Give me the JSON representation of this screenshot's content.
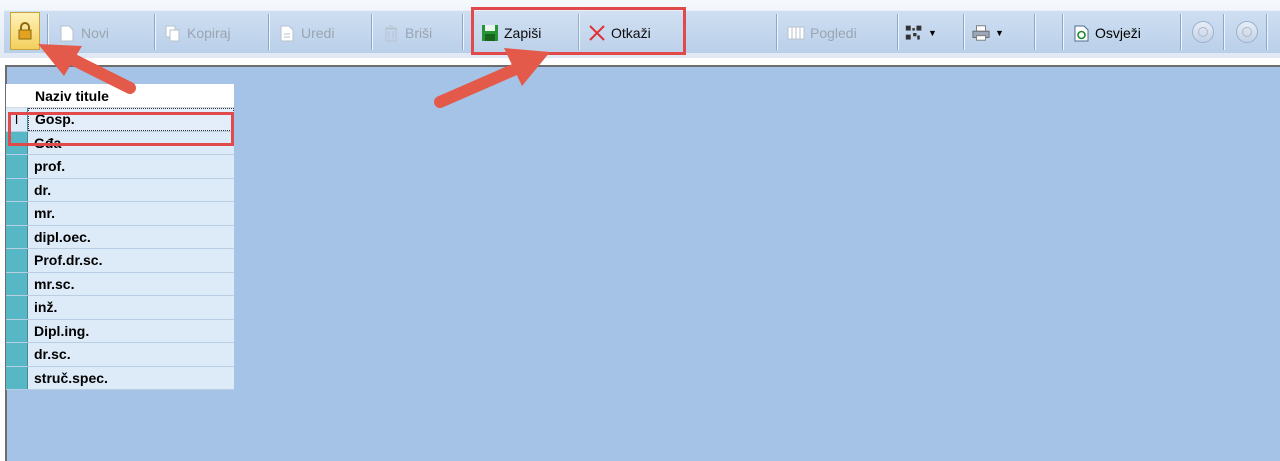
{
  "toolbar": {
    "lock_icon": "lock-icon",
    "buttons": [
      {
        "label": "Novi",
        "icon": "new-document-icon",
        "enabled": false
      },
      {
        "label": "Kopiraj",
        "icon": "copy-icon",
        "enabled": false
      },
      {
        "label": "Uredi",
        "icon": "edit-icon",
        "enabled": false
      },
      {
        "label": "Briši",
        "icon": "trash-icon",
        "enabled": false
      },
      {
        "label": "Zapiši",
        "icon": "save-icon",
        "enabled": true
      },
      {
        "label": "Otkaži",
        "icon": "cancel-icon",
        "enabled": true
      },
      {
        "label": "Pogledi",
        "icon": "views-icon",
        "enabled": false
      },
      {
        "label": "Osvježi",
        "icon": "refresh-icon",
        "enabled": true
      }
    ],
    "highlight_color": "#e04a4a"
  },
  "grid": {
    "column_header": "Naziv titule",
    "active_marker": "I",
    "rows": [
      "Gosp.",
      "Gđa",
      "prof.",
      "dr.",
      "mr.",
      "dipl.oec.",
      "Prof.dr.sc.",
      "mr.sc.",
      "inž.",
      "Dipl.ing.",
      "dr.sc.",
      "struč.spec."
    ]
  },
  "colors": {
    "workspace": "#a4c3e6",
    "row_indicator": "#58b7c5",
    "cell": "#ddeaf7",
    "annotation_red": "#e04a4a"
  }
}
